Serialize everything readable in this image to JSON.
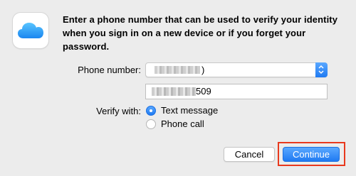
{
  "message": "Enter a phone number that can be used to verify your identity when you sign in on a new device or if you forget your password.",
  "form": {
    "phone_label": "Phone number:",
    "country_value": ")",
    "phone_value_visible": "509",
    "verify_label": "Verify with:",
    "options": [
      {
        "label": "Text message",
        "selected": true
      },
      {
        "label": "Phone call",
        "selected": false
      }
    ]
  },
  "buttons": {
    "cancel": "Cancel",
    "continue": "Continue"
  },
  "colors": {
    "accent": "#1f7af2",
    "highlight": "#e8391e",
    "dialog_bg": "#ececec"
  },
  "icons": {
    "app": "icloud-icon",
    "stepper": "chevron-up-down-icon"
  }
}
